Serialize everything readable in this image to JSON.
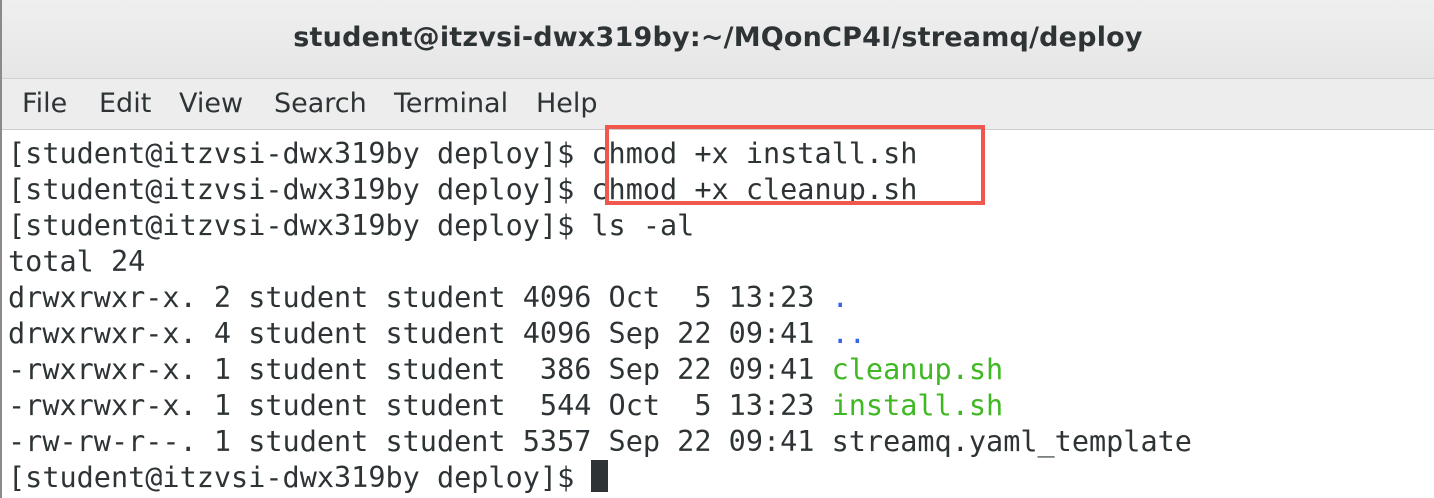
{
  "window": {
    "title": "student@itzvsi-dwx319by:~/MQonCP4I/streamq/deploy"
  },
  "menu": [
    "File",
    "Edit",
    "View",
    "Search",
    "Terminal",
    "Help"
  ],
  "terminal": {
    "prompt": "[student@itzvsi-dwx319by deploy]$ ",
    "commands": [
      "chmod +x install.sh",
      "chmod +x cleanup.sh",
      "ls -al"
    ],
    "total_line": "total 24",
    "listing": [
      {
        "meta": "drwxrwxr-x. 2 student student 4096 Oct  5 13:23 ",
        "name": ".",
        "kind": "dir"
      },
      {
        "meta": "drwxrwxr-x. 4 student student 4096 Sep 22 09:41 ",
        "name": "..",
        "kind": "dir"
      },
      {
        "meta": "-rwxrwxr-x. 1 student student  386 Sep 22 09:41 ",
        "name": "cleanup.sh",
        "kind": "exec"
      },
      {
        "meta": "-rwxrwxr-x. 1 student student  544 Oct  5 13:23 ",
        "name": "install.sh",
        "kind": "exec"
      },
      {
        "meta": "-rw-rw-r--. 1 student student 5357 Sep 22 09:41 ",
        "name": "streamq.yaml_template",
        "kind": "file"
      }
    ]
  },
  "colors": {
    "dir": "#3465e4",
    "exec": "#3fb823",
    "highlight": "#f0574d"
  }
}
